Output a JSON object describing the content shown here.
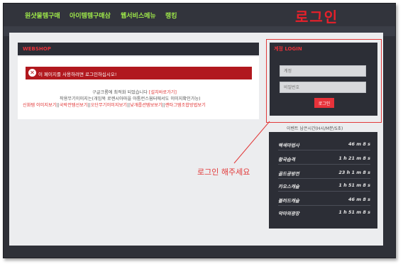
{
  "nav": {
    "items": [
      "원샷물템구매",
      "아이템템구매삼",
      "웹서비스메뉴",
      "랭킹"
    ]
  },
  "annotation": {
    "title": "로그인",
    "note": "로그인 해주세요"
  },
  "webshop": {
    "header": "WEBSHOP",
    "alert": "이 페이지를 사용하려면 로그인하십시오!",
    "line1_pre": "구글크롬에 최적화 되었습니다",
    "line1_link": "[설치바로가기]",
    "line2": "착용무기이미지는(개임북 로렌시아마을 아툼런스웜터에서도 이미지확인가능)",
    "line3_links": [
      "신화템 이미지보기",
      "국락전템선보기",
      "오단무기이미지보기",
      "낮개룹션템보보기",
      "랜타그템조합방법보기"
    ],
    "line3_seps": [
      "||",
      "||",
      "||",
      "||"
    ]
  },
  "login": {
    "title": "계정 LOGIN",
    "id_placeholder": "계정",
    "pw_placeholder": "비밀번호",
    "button": "로그인"
  },
  "events": {
    "caption": "이벤트 남은시간(H시/M분/S초)",
    "rows": [
      {
        "name": "백색마법사",
        "time": "46 m 8 s"
      },
      {
        "name": "황국습격",
        "time": "1 h 21 m 8 s"
      },
      {
        "name": "골드공방전",
        "time": "23 h 1 m 8 s"
      },
      {
        "name": "카오스캐슬",
        "time": "1 h 51 m 8 s"
      },
      {
        "name": "블러드캐슬",
        "time": "46 m 8 s"
      },
      {
        "name": "악마의광장",
        "time": "1 h 51 m 8 s"
      }
    ]
  },
  "colors": {
    "accent_red": "#e8323a",
    "nav_green": "#9ee84a",
    "panel_dark": "#2c2e36"
  }
}
